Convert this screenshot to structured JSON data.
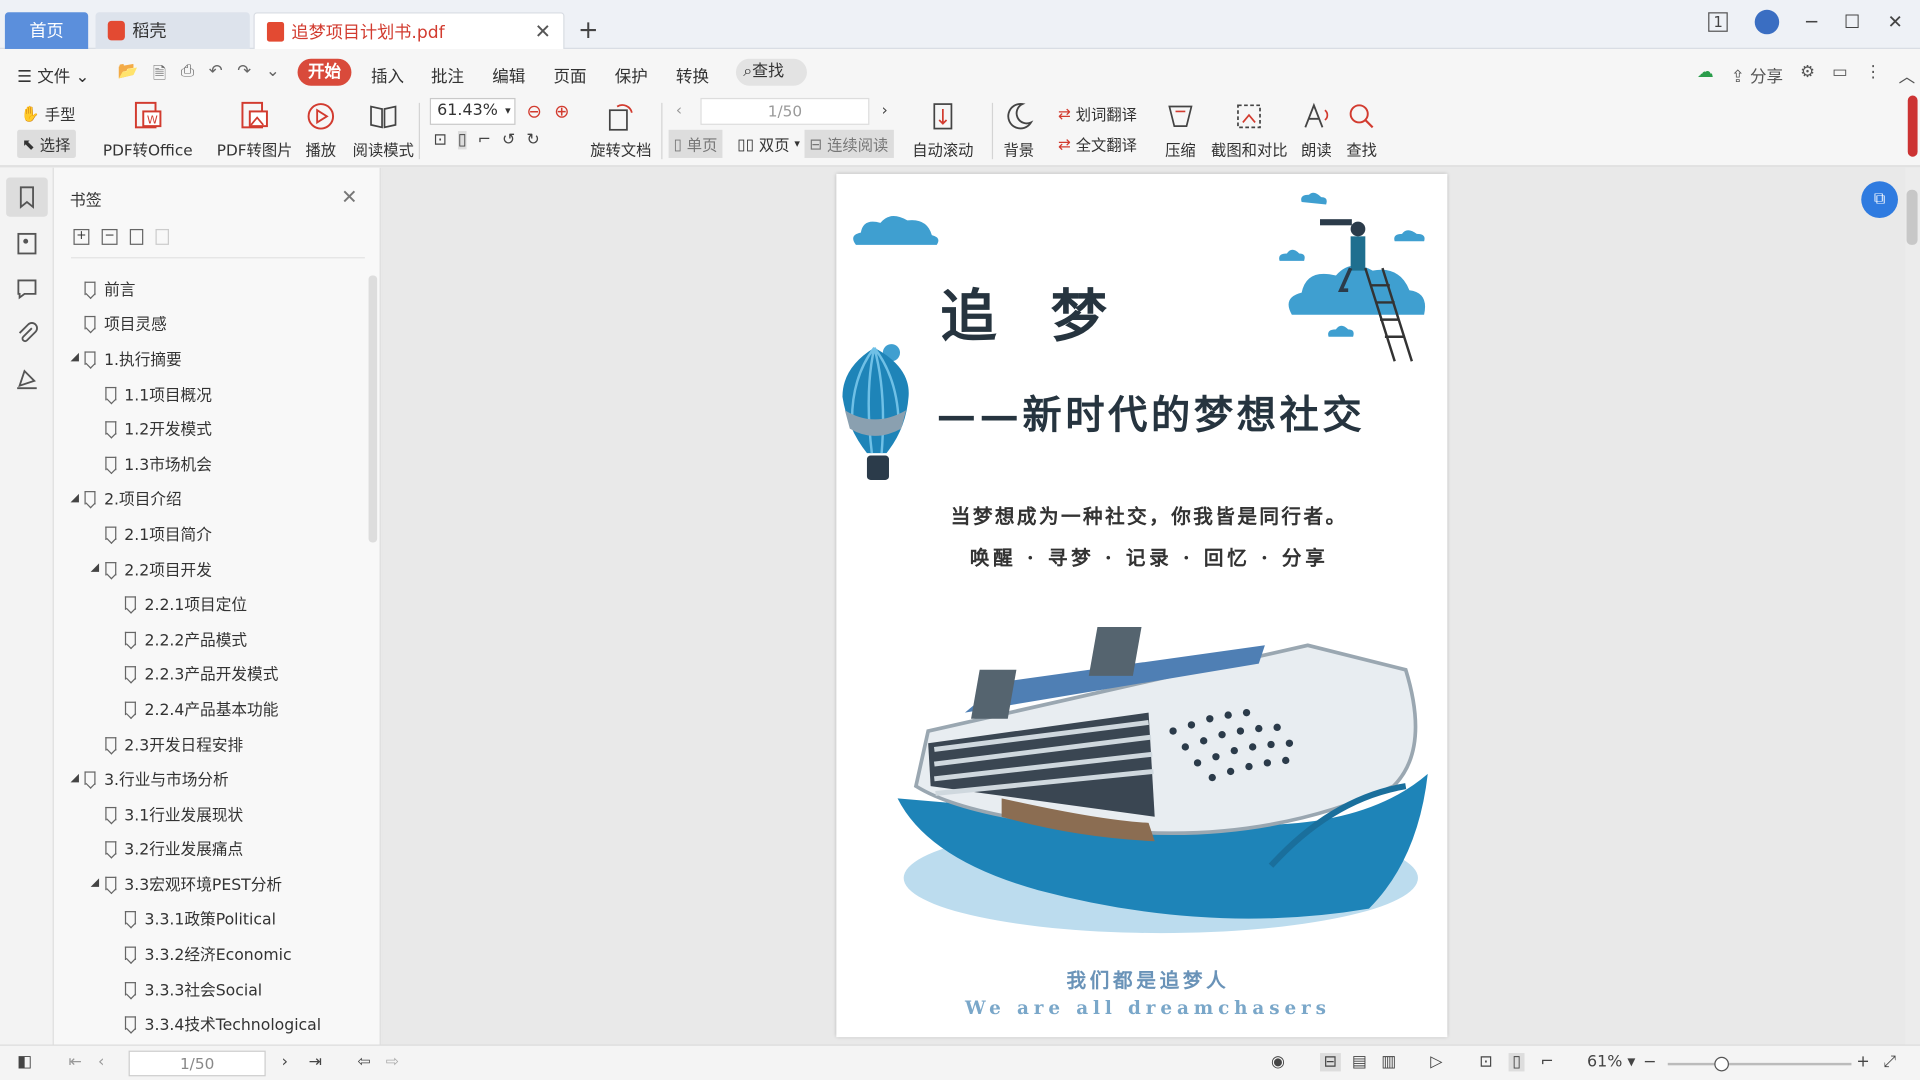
{
  "tabs": {
    "home": "首页",
    "daoke": "稻壳",
    "document": "追梦项目计划书.pdf"
  },
  "menu": {
    "file": "文件",
    "ribbon_tabs": [
      "开始",
      "插入",
      "批注",
      "编辑",
      "页面",
      "保护",
      "转换"
    ],
    "search": "查找",
    "share": "分享"
  },
  "toolbar": {
    "hand": "手型",
    "select": "选择",
    "pdf_to_office": "PDF转Office",
    "pdf_to_image": "PDF转图片",
    "play": "播放",
    "read_mode": "阅读模式",
    "zoom": "61.43%",
    "rotate": "旋转文档",
    "page_indicator": "1/50",
    "single": "单页",
    "double": "双页",
    "continuous": "连续阅读",
    "auto_scroll": "自动滚动",
    "background": "背景",
    "word_translate": "划词翻译",
    "full_translate": "全文翻译",
    "compress": "压缩",
    "screenshot_compare": "截图和对比",
    "read_aloud": "朗读",
    "find": "查找"
  },
  "sidebar": {
    "title": "书签",
    "bookmarks": [
      {
        "label": "前言",
        "level": 0,
        "arrow": ""
      },
      {
        "label": "项目灵感",
        "level": 0,
        "arrow": ""
      },
      {
        "label": "1.执行摘要",
        "level": 0,
        "arrow": "◢"
      },
      {
        "label": "1.1项目概况",
        "level": 1,
        "arrow": ""
      },
      {
        "label": "1.2开发模式",
        "level": 1,
        "arrow": ""
      },
      {
        "label": "1.3市场机会",
        "level": 1,
        "arrow": ""
      },
      {
        "label": "2.项目介绍",
        "level": 0,
        "arrow": "◢"
      },
      {
        "label": "2.1项目简介",
        "level": 1,
        "arrow": ""
      },
      {
        "label": "2.2项目开发",
        "level": 1,
        "arrow": "◢"
      },
      {
        "label": "2.2.1项目定位",
        "level": 2,
        "arrow": ""
      },
      {
        "label": "2.2.2产品模式",
        "level": 2,
        "arrow": ""
      },
      {
        "label": "2.2.3产品开发模式",
        "level": 2,
        "arrow": ""
      },
      {
        "label": "2.2.4产品基本功能",
        "level": 2,
        "arrow": ""
      },
      {
        "label": "2.3开发日程安排",
        "level": 1,
        "arrow": ""
      },
      {
        "label": "3.行业与市场分析",
        "level": 0,
        "arrow": "◢"
      },
      {
        "label": "3.1行业发展现状",
        "level": 1,
        "arrow": ""
      },
      {
        "label": "3.2行业发展痛点",
        "level": 1,
        "arrow": ""
      },
      {
        "label": "3.3宏观环境PEST分析",
        "level": 1,
        "arrow": "◢"
      },
      {
        "label": "3.3.1政策Political",
        "level": 2,
        "arrow": ""
      },
      {
        "label": "3.3.2经济Economic",
        "level": 2,
        "arrow": ""
      },
      {
        "label": "3.3.3社会Social",
        "level": 2,
        "arrow": ""
      },
      {
        "label": "3.3.4技术Technological",
        "level": 2,
        "arrow": ""
      }
    ]
  },
  "page": {
    "title": "追 梦",
    "subtitle": "——新时代的梦想社交",
    "line1": "当梦想成为一种社交，你我皆是同行者。",
    "line2": "唤醒 · 寻梦 · 记录 · 回忆 · 分享",
    "footer_cn": "我们都是追梦人",
    "footer_en": "We are all dreamchasers"
  },
  "status": {
    "page": "1/50",
    "zoom": "61%"
  },
  "colors": {
    "accent": "#d94a3b",
    "tab_blue": "#5b8fdc",
    "ship_blue": "#1e84b8"
  }
}
